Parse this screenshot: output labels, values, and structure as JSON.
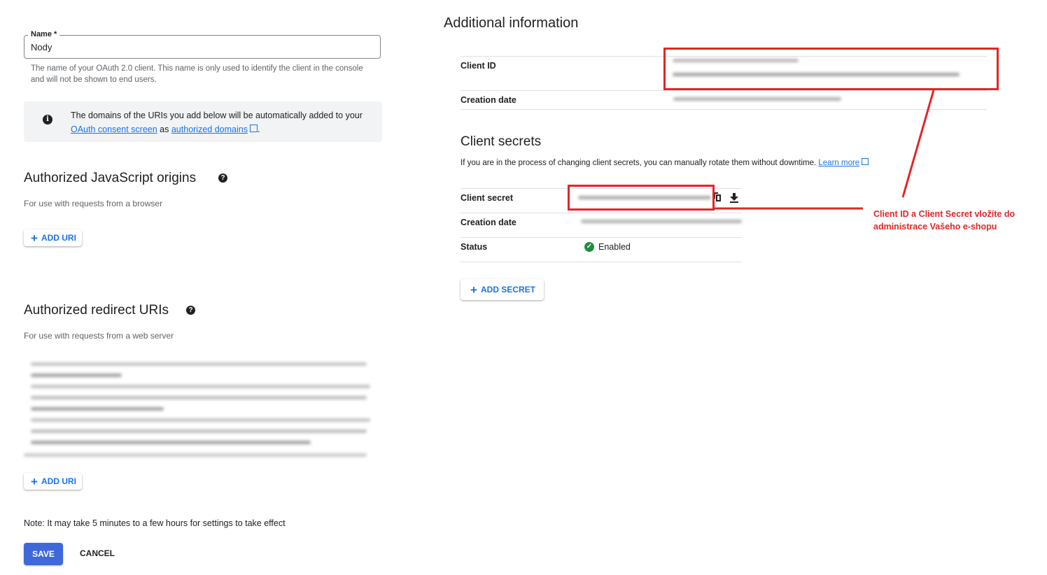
{
  "name_field": {
    "label": "Name *",
    "value": "Nody",
    "hint": "The name of your OAuth 2.0 client. This name is only used to identify the client in the console and will not be shown to end users."
  },
  "info_box": {
    "icon": "info-icon",
    "text_before": "The domains of the URIs you add below will be automatically added to your",
    "link1": "OAuth consent screen",
    "text_middle": "as",
    "link2": "authorized domains",
    "text_after": "."
  },
  "js_origins": {
    "title": "Authorized JavaScript origins",
    "help_icon": "?",
    "subtitle": "For use with requests from a browser",
    "add_label": "ADD URI"
  },
  "redirect_uris": {
    "title": "Authorized redirect URIs",
    "help_icon": "?",
    "subtitle": "For use with requests from a web server",
    "add_label": "ADD URI"
  },
  "note": "Note: It may take 5 minutes to a few hours for settings to take effect",
  "actions": {
    "save": "SAVE",
    "cancel": "CANCEL"
  },
  "additional_info": {
    "title": "Additional information",
    "client_id_label": "Client ID",
    "creation_date_label": "Creation date"
  },
  "client_secrets": {
    "title": "Client secrets",
    "description": "If you are in the process of changing client secrets, you can manually rotate them without downtime.",
    "learn_more": "Learn more",
    "secret_label": "Client secret",
    "creation_date_label": "Creation date",
    "status_label": "Status",
    "status_value": "Enabled",
    "add_secret": "ADD SECRET"
  },
  "annotation": "Client ID a Client Secret vložíte do administrace Vašeho e-shopu",
  "colors": {
    "link": "#1a73e8",
    "annotation": "#e32526",
    "save": "#3f69d8",
    "enabled": "#1e8e3e"
  }
}
